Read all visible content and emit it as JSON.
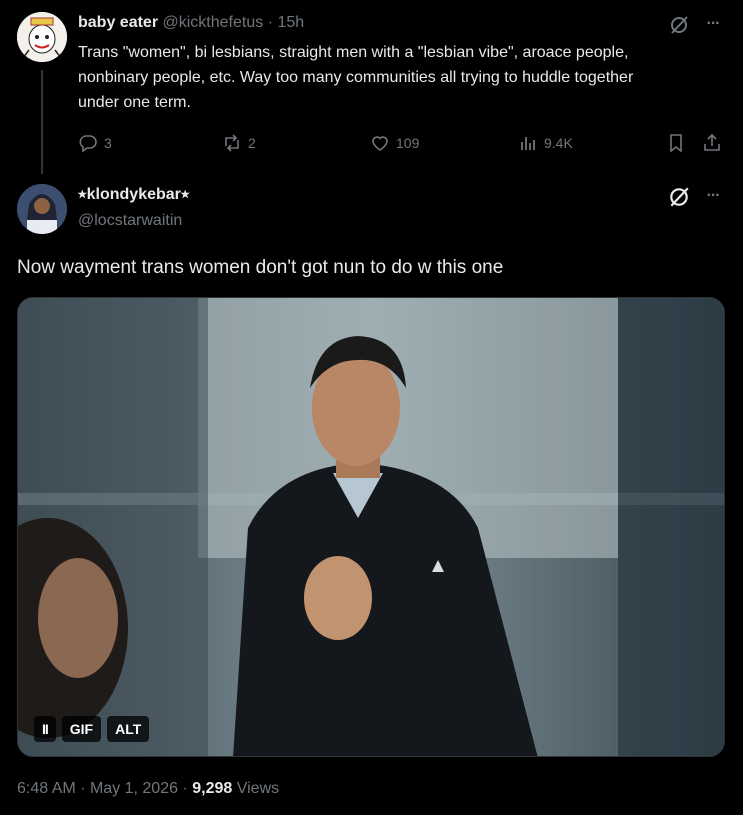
{
  "tweet1": {
    "display_name": "baby eater",
    "handle": "@kickthefetus",
    "separator": "·",
    "time": "15h",
    "text": "Trans \"women\", bi lesbians, straight men with a \"lesbian vibe\", aroace people, nonbinary people, etc. Way too many communities all trying to huddle together under one term.",
    "replies": "3",
    "reposts": "2",
    "likes": "109",
    "views": "9.4K",
    "more_glyph": "···"
  },
  "tweet2": {
    "display_name": "⭒klondykebar⭒",
    "handle": "@locstarwaitin",
    "more_glyph": "···",
    "text": "Now wayment trans women don't got nun to do w this one",
    "media": {
      "pause_label": "II",
      "gif_label": "GIF",
      "alt_label": "ALT"
    },
    "footer": {
      "time": "6:48 AM",
      "sep1": "·",
      "date": "May 1, 2026",
      "sep2": "·",
      "views_count": "9,298",
      "views_label": "Views"
    }
  },
  "colors": {
    "background": "#000000",
    "text": "#e7e9ea",
    "muted": "#71767b",
    "border": "#2f3336"
  }
}
